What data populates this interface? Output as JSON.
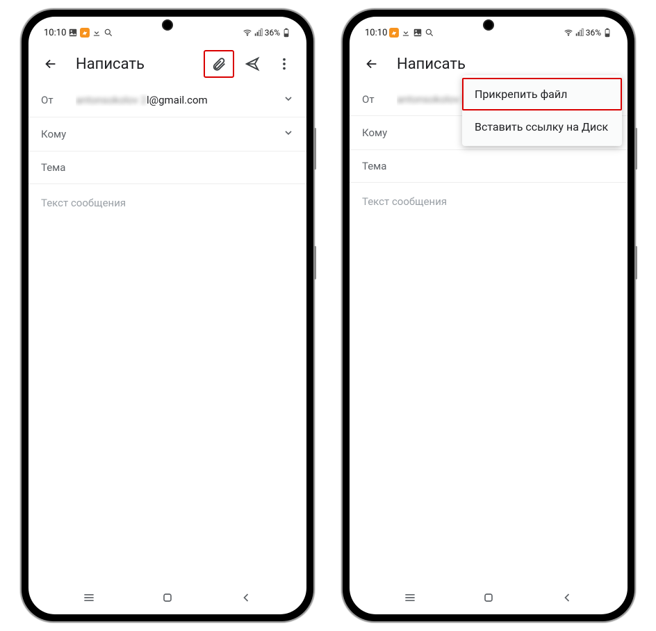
{
  "status": {
    "time": "10:10",
    "battery_text": "36%"
  },
  "compose": {
    "title": "Написать",
    "from_label": "От",
    "from_value_blur": "antonsokolov 2",
    "from_value_tail": "l@gmail.com",
    "to_label": "Кому",
    "subject_placeholder": "Тема",
    "body_placeholder": "Текст сообщения"
  },
  "menu": {
    "attach_file": "Прикрепить файл",
    "insert_drive": "Вставить ссылку на Диск"
  }
}
